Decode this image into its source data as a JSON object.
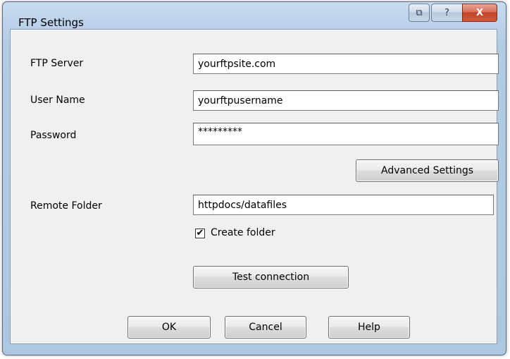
{
  "window": {
    "title": "FTP Settings"
  },
  "caption": {
    "help_glyph": "?",
    "close_glyph": "X",
    "extra_glyph": "⧉"
  },
  "form": {
    "ftp_server": {
      "label": "FTP Server",
      "value": "yourftpsite.com"
    },
    "user_name": {
      "label": "User Name",
      "value": "yourftpusername"
    },
    "password": {
      "label": "Password",
      "value": "*********"
    },
    "advanced_label": "Advanced Settings",
    "remote_folder": {
      "label": "Remote Folder",
      "value": "httpdocs/datafiles"
    },
    "create_folder": {
      "label": "Create folder",
      "checked": true,
      "check_glyph": "✔"
    },
    "test_label": "Test connection"
  },
  "buttons": {
    "ok": "OK",
    "cancel": "Cancel",
    "help": "Help"
  }
}
